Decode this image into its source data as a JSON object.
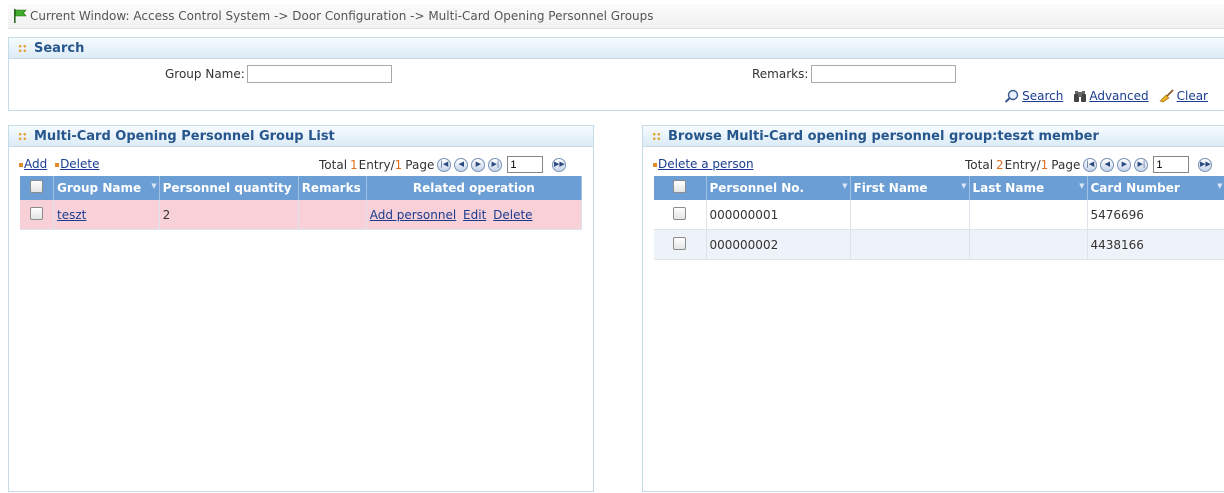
{
  "breadcrumb": {
    "text": "Current Window: Access Control System -> Door Configuration -> Multi-Card Opening Personnel Groups",
    "icon": "flag-icon"
  },
  "search": {
    "title": "Search",
    "group_name_label": "Group Name:",
    "group_name_value": "",
    "remarks_label": "Remarks:",
    "remarks_value": "",
    "search_label": "Search",
    "advanced_label": "Advanced",
    "clear_label": "Clear"
  },
  "group_list": {
    "title": "Multi-Card Opening Personnel Group List",
    "add_label": "Add",
    "delete_label": "Delete",
    "pager": {
      "total_label": "Total",
      "count": "1",
      "entry_label": "Entry/",
      "pages": "1",
      "page_label": "Page",
      "page_input": "1"
    },
    "columns": [
      "Group Name",
      "Personnel quantity",
      "Remarks",
      "Related operation"
    ],
    "rows": [
      {
        "group_name": "teszt",
        "quantity": "2",
        "remarks": "",
        "add_personnel": "Add personnel",
        "edit": "Edit",
        "delete": "Delete"
      }
    ]
  },
  "members": {
    "title": "Browse Multi-Card opening personnel group:teszt member",
    "delete_person_label": "Delete a person",
    "pager": {
      "total_label": "Total",
      "count": "2",
      "entry_label": "Entry/",
      "pages": "1",
      "page_label": "Page",
      "page_input": "1"
    },
    "columns": [
      "Personnel No.",
      "First Name",
      "Last Name",
      "Card Number"
    ],
    "rows": [
      {
        "personnel_no": "000000001",
        "first_name": "",
        "last_name": "",
        "card_number": "5476696"
      },
      {
        "personnel_no": "000000002",
        "first_name": "",
        "last_name": "",
        "card_number": "4438166"
      }
    ]
  },
  "colors": {
    "header_bg": "#6b9ed4",
    "selected_row": "#f8d0d8",
    "link": "#1a3d8f",
    "accent": "#e07020",
    "panel_title": "#27568c"
  }
}
